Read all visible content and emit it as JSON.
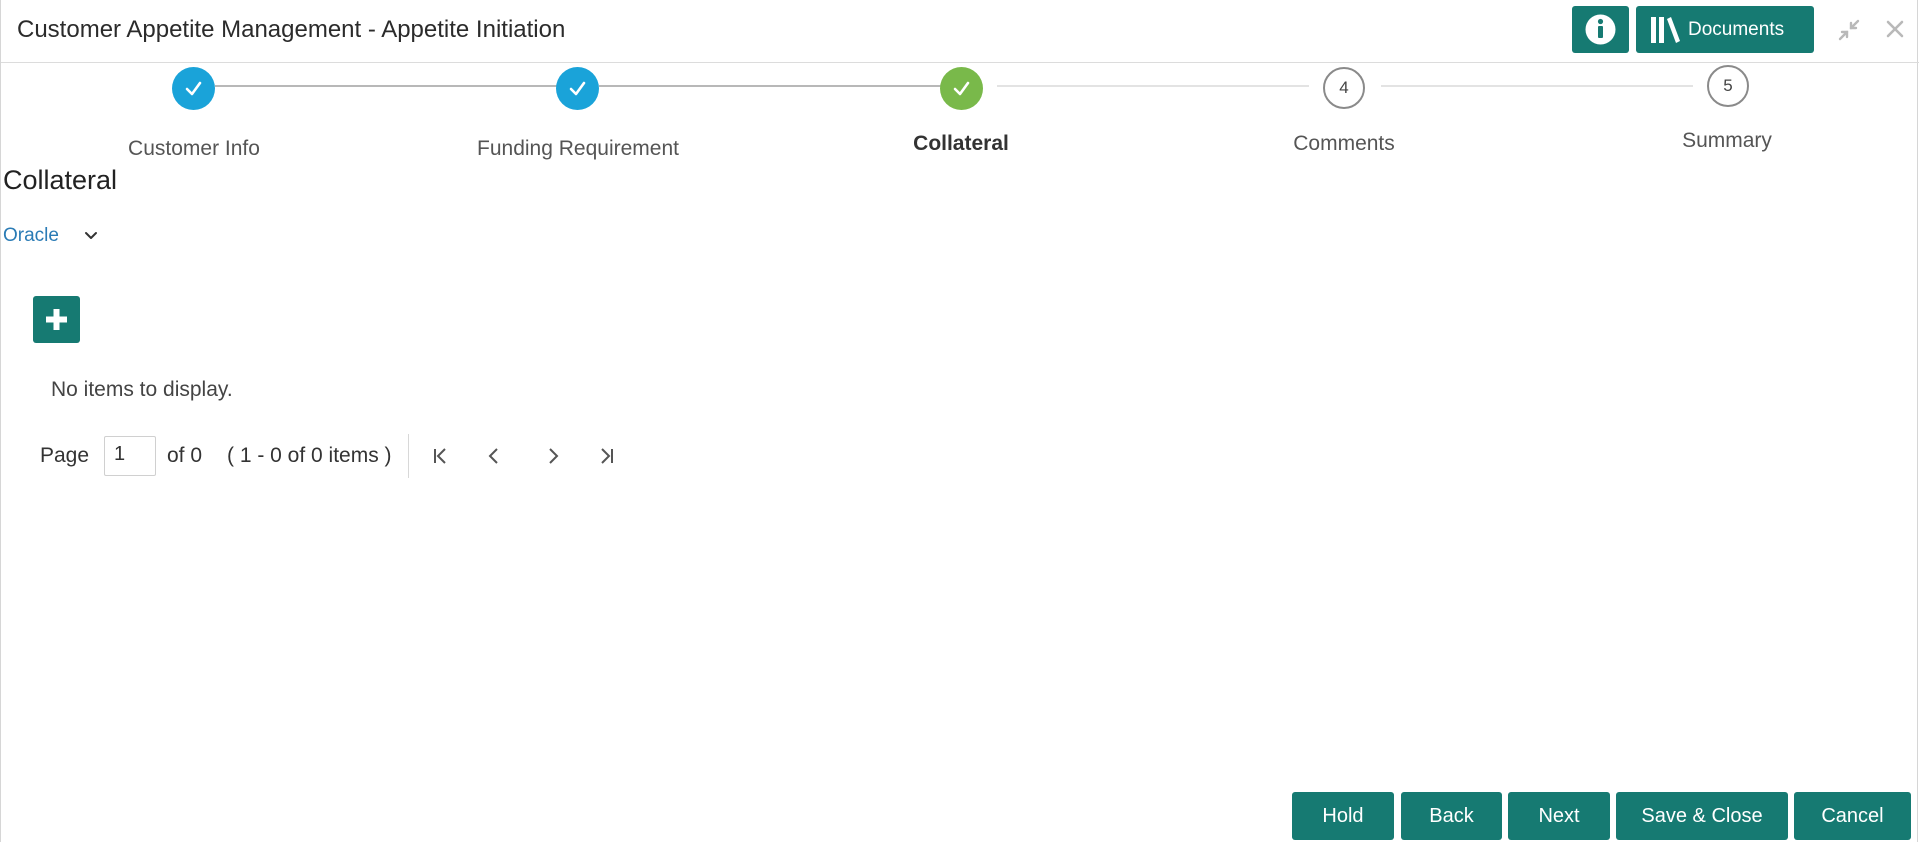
{
  "header": {
    "title": "Customer Appetite Management - Appetite Initiation",
    "documents_label": "Documents",
    "info_icon": "info-icon",
    "documents_icon": "library-icon",
    "accent_color": "#167a72"
  },
  "stepper": {
    "steps": [
      {
        "label": "Customer Info",
        "state": "done"
      },
      {
        "label": "Funding Requirement",
        "state": "done"
      },
      {
        "label": "Collateral",
        "state": "active"
      },
      {
        "label": "Comments",
        "number": "4",
        "state": "pending"
      },
      {
        "label": "Summary",
        "number": "5",
        "state": "pending"
      }
    ],
    "done_color": "#1aa3d9",
    "active_color": "#79b94a"
  },
  "section": {
    "title": "Collateral",
    "source_link": "Oracle",
    "empty_message": "No items to display."
  },
  "pagination": {
    "page_label": "Page",
    "current_page": "1",
    "of_label": "of 0",
    "range_label": "( 1 - 0 of 0 items )"
  },
  "footer": {
    "hold": "Hold",
    "back": "Back",
    "next": "Next",
    "save_close": "Save & Close",
    "cancel": "Cancel"
  }
}
